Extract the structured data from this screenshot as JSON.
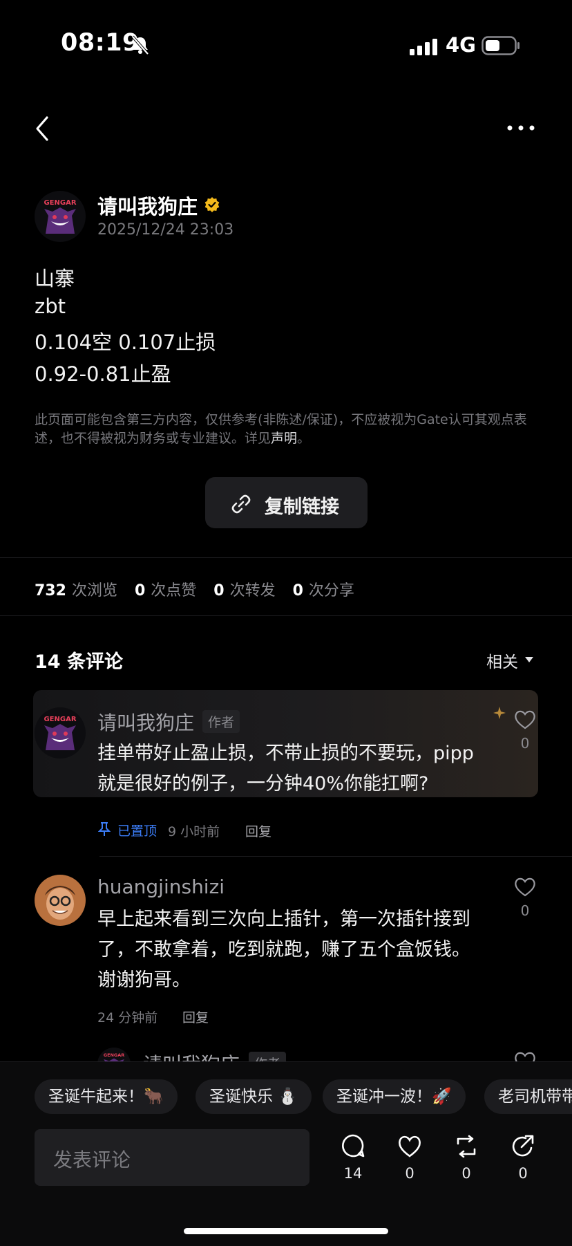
{
  "status_bar": {
    "time": "08:19",
    "network": "4G"
  },
  "post": {
    "author": {
      "name": "请叫我狗庄",
      "avatar_text": "GENGAR"
    },
    "timestamp": "2025/12/24 23:03",
    "content_lines": [
      "山寨",
      "zbt",
      "0.104空  0.107止损",
      "0.92-0.81止盈"
    ],
    "disclaimer_text": "此页面可能包含第三方内容，仅供参考(非陈述/保证)，不应被视为Gate认可其观点表述，也不得被视为财务或专业建议。详见",
    "disclaimer_link": "声明",
    "disclaimer_end": "。",
    "copy_link_label": "复制链接"
  },
  "stats": [
    {
      "value": "732",
      "label": "次浏览"
    },
    {
      "value": "0",
      "label": "次点赞"
    },
    {
      "value": "0",
      "label": "次转发"
    },
    {
      "value": "0",
      "label": "次分享"
    }
  ],
  "comments_section": {
    "title": "14 条评论",
    "sort_label": "相关"
  },
  "comments": [
    {
      "name": "请叫我狗庄",
      "tag": "作者",
      "text_lines": [
        "挂单带好止盈止损，不带止损的不要玩，pipp",
        "就是很好的例子，一分钟40%你能扛啊?"
      ],
      "pinned_label": "已置顶",
      "time": "9 小时前",
      "reply": "回复",
      "likes": "0"
    },
    {
      "name": "huangjinshizi",
      "text_lines": [
        "早上起来看到三次向上插针，第一次插针接到",
        "了，不敢拿着，吃到就跑，赚了五个盒饭钱。",
        "谢谢狗哥。"
      ],
      "time": "24 分钟前",
      "reply": "回复",
      "likes": "0"
    },
    {
      "name": "请叫我狗庄",
      "tag": "作者"
    }
  ],
  "quick_replies": [
    "圣诞牛起来！🐂",
    "圣诞快乐 ⛄",
    "圣诞冲一波！🚀",
    "老司机带带"
  ],
  "comment_input": {
    "placeholder": "发表评论"
  },
  "actions": [
    {
      "icon": "comment-icon",
      "count": "14"
    },
    {
      "icon": "heart-icon",
      "count": "0"
    },
    {
      "icon": "repost-icon",
      "count": "0"
    },
    {
      "icon": "share-icon",
      "count": "0"
    }
  ],
  "colors": {
    "background": "#000000",
    "pinned": "#3b7cf5",
    "verified": "#f3b91b"
  }
}
